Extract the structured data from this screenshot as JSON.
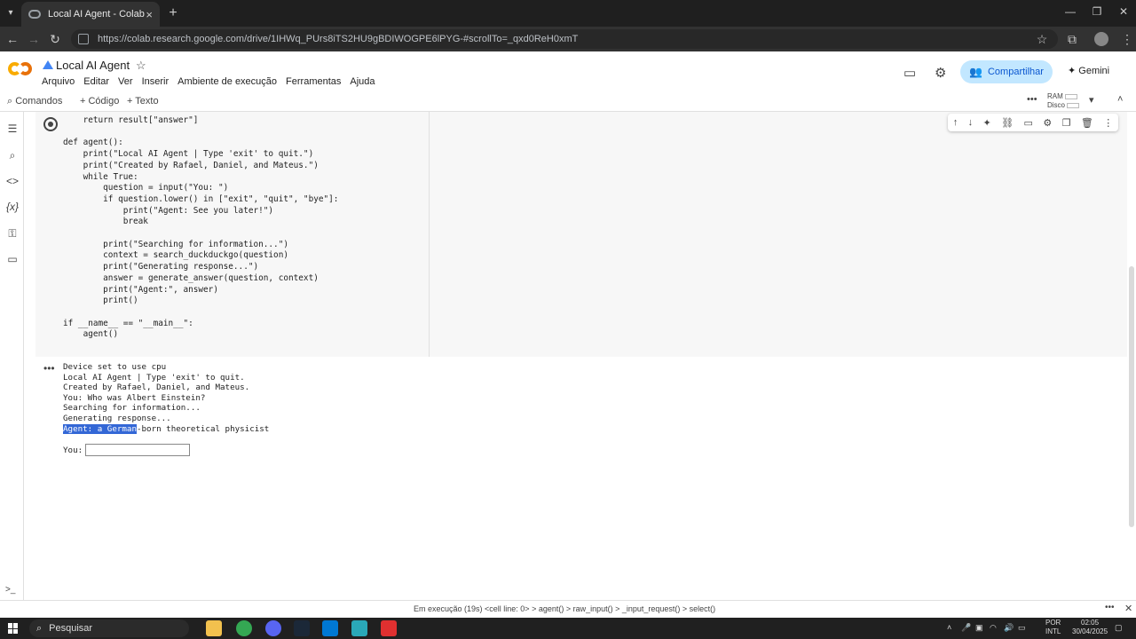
{
  "browser": {
    "tab_title": "Local AI Agent - Colab",
    "url": "https://colab.research.google.com/drive/1IHWq_PUrs8iTS2HU9gBDIWOGPE6lPYG-#scrollTo=_qxd0ReH0xmT"
  },
  "colab": {
    "notebook_title": "Local AI Agent",
    "menu": [
      "Arquivo",
      "Editar",
      "Ver",
      "Inserir",
      "Ambiente de execução",
      "Ferramentas",
      "Ajuda"
    ],
    "share_label": "Compartilhar",
    "gemini_label": "Gemini"
  },
  "toolbar": {
    "commands_label": "Comandos",
    "code_label": "Código",
    "text_label": "Texto",
    "ram_label": "RAM",
    "disk_label": "Disco"
  },
  "code_lines": [
    "    return result[\"answer\"]",
    "",
    "def agent():",
    "    print(\"Local AI Agent | Type 'exit' to quit.\")",
    "    print(\"Created by Rafael, Daniel, and Mateus.\")",
    "    while True:",
    "        question = input(\"You: \")",
    "        if question.lower() in [\"exit\", \"quit\", \"bye\"]:",
    "            print(\"Agent: See you later!\")",
    "            break",
    "",
    "        print(\"Searching for information...\")",
    "        context = search_duckduckgo(question)",
    "        print(\"Generating response...\")",
    "        answer = generate_answer(question, context)",
    "        print(\"Agent:\", answer)",
    "        print()",
    "",
    "if __name__ == \"__main__\":",
    "    agent()"
  ],
  "output_lines": [
    "Device set to use cpu",
    "Local AI Agent | Type 'exit' to quit.",
    "Created by Rafael, Daniel, and Mateus.",
    "You: Who was Albert Einstein?",
    "Searching for information...",
    "Generating response..."
  ],
  "output_last_selected": "Agent: a German",
  "output_last_rest": "-born theoretical physicist",
  "input_prompt": "You:",
  "input_value": "",
  "status": {
    "text": "Em execução (19s)  <cell line: 0> > agent() > raw_input() > _input_request() > select()"
  },
  "taskbar": {
    "search_placeholder": "Pesquisar",
    "lang_line1": "POR",
    "lang_line2": "INTL",
    "time": "02:05",
    "date": "30/04/2025"
  }
}
